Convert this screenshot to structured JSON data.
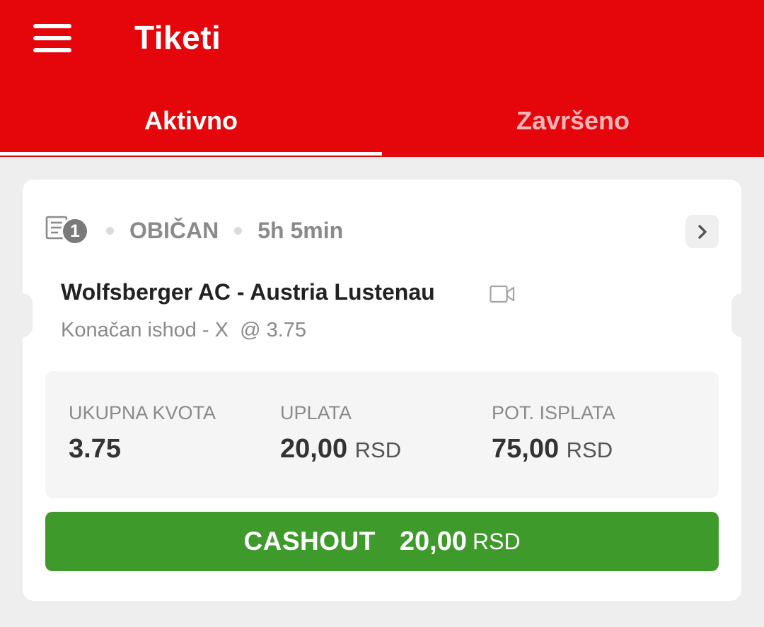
{
  "header": {
    "title": "Tiketi",
    "menu_icon": "hamburger-menu-icon",
    "background_color": "#e4060b"
  },
  "tabs": [
    {
      "label": "Aktivno",
      "active": true
    },
    {
      "label": "Završeno",
      "active": false
    }
  ],
  "ticket": {
    "icon": "ticket-list-icon",
    "event_count": "1",
    "type": "OBIČAN",
    "time": "5h 5min",
    "detail_icon": "chevron-right-icon",
    "match": "Wolfsberger AC - Austria Lustenau",
    "video_icon": "video-camera-icon",
    "selection": "Konačan ishod - X  @ 3.75",
    "stats": {
      "total_odds_label": "UKUPNA KVOTA",
      "total_odds_value": "3.75",
      "stake_label": "UPLATA",
      "stake_value": "20,00",
      "stake_currency": "RSD",
      "payout_label": "POT. ISPLATA",
      "payout_value": "75,00",
      "payout_currency": "RSD"
    },
    "cashout": {
      "label": "CASHOUT",
      "amount": "20,00",
      "currency": "RSD",
      "color": "#3f9a2c"
    }
  }
}
